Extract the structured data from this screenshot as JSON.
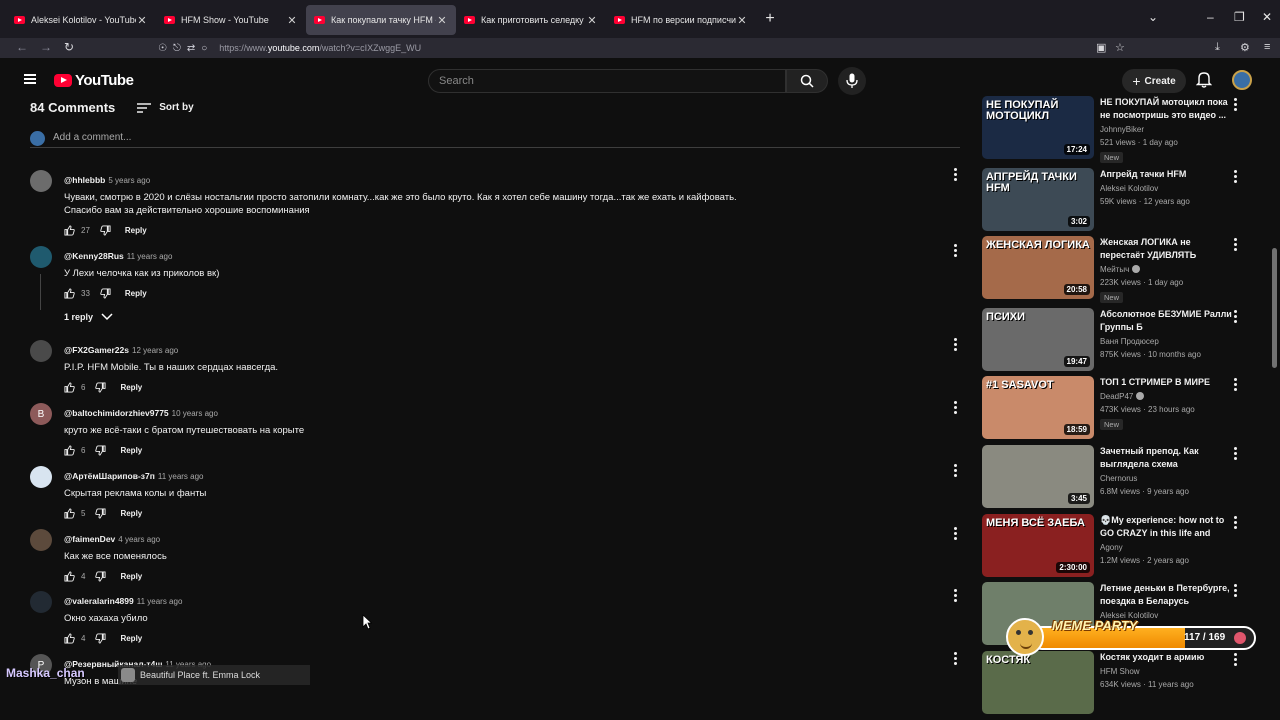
{
  "browser": {
    "tabs": [
      {
        "title": "Aleksei Kolotilov - YouTube",
        "active": false
      },
      {
        "title": "HFM Show - YouTube",
        "active": false
      },
      {
        "title": "Как покупали тачку HFM - YouTube",
        "active": true
      },
      {
        "title": "Как приготовить селедку под шубой",
        "active": false
      },
      {
        "title": "HFM по версии подписчиков",
        "active": false
      }
    ],
    "url_prefix": "https://www.",
    "url_host": "youtube.com",
    "url_path": "/watch?v=cIXZwggE_WU"
  },
  "header": {
    "logo_text": "YouTube",
    "search_placeholder": "Search",
    "create_label": "Create"
  },
  "comments_section": {
    "count_label": "84 Comments",
    "sort_label": "Sort by",
    "add_placeholder": "Add a comment...",
    "items": [
      {
        "author": "@hhlebbb",
        "time": "5 years ago",
        "text": "Чуваки, смотрю в 2020 и слёзы ностальгии просто затопили комнату...как же это было круто. Как я хотел себе машину тогда...так же ехать и кайфовать.",
        "text2": "Спасибо вам за действительно хорошие воспоминания",
        "likes": "27",
        "reply": "Reply",
        "avatar_color": "#6c6c6c",
        "initial": ""
      },
      {
        "author": "@Kenny28Rus",
        "time": "11 years ago",
        "text": "У Лехи челочка как из приколов вк)",
        "text2": "",
        "likes": "33",
        "reply": "Reply",
        "avatar_color": "#1f5a6e",
        "initial": ""
      },
      {
        "author": "@FX2Gamer22s",
        "time": "12 years ago",
        "text": "P.I.P. HFM Mobile. Ты в наших сердцах навсегда.",
        "text2": "",
        "likes": "6",
        "reply": "Reply",
        "avatar_color": "#4a4a4a",
        "initial": ""
      },
      {
        "author": "@baltochimidorzhiev9775",
        "time": "10 years ago",
        "text": "круто же всё-таки с братом путешествовать на корыте",
        "text2": "",
        "likes": "6",
        "reply": "Reply",
        "avatar_color": "#8d5a5a",
        "initial": "B"
      },
      {
        "author": "@АртёмШарипов-з7п",
        "time": "11 years ago",
        "text": "Скрытая реклама колы и фанты",
        "text2": "",
        "likes": "5",
        "reply": "Reply",
        "avatar_color": "#d8e4f0",
        "initial": ""
      },
      {
        "author": "@faimenDev",
        "time": "4 years ago",
        "text": "Как же все поменялось",
        "text2": "",
        "likes": "4",
        "reply": "Reply",
        "avatar_color": "#5c4a3c",
        "initial": ""
      },
      {
        "author": "@valeralarin4899",
        "time": "11 years ago",
        "text": "Окно хахаха убило",
        "text2": "",
        "likes": "4",
        "reply": "Reply",
        "avatar_color": "#222a33",
        "initial": ""
      },
      {
        "author": "@Резервныйканал-т4ш",
        "time": "11 years ago",
        "text": "Музон в машине",
        "text2": "",
        "likes": "",
        "reply": "",
        "avatar_color": "#555",
        "initial": "P"
      }
    ],
    "replies_toggle": "1 reply"
  },
  "recommendations": [
    {
      "title": "НЕ ПОКУПАЙ мотоцикл пока не посмотришь это видео ...",
      "channel": "JohnnyBiker",
      "views": "521 views",
      "age": "1 day ago",
      "new": "New",
      "duration": "17:24",
      "thumb_text": "НЕ ПОКУПАЙ МОТОЦИКЛ",
      "thumb_color": "#1b2a44",
      "verified": false
    },
    {
      "title": "Апгрейд тачки HFM",
      "channel": "Aleksei Kolotilov",
      "views": "59K views",
      "age": "12 years ago",
      "new": "",
      "duration": "3:02",
      "thumb_text": "АПГРЕЙД ТАЧКИ HFM",
      "thumb_color": "#3d4a55",
      "verified": false
    },
    {
      "title": "Женская ЛОГИКА не перестаёт УДИВЛЯТЬ",
      "channel": "Мейтыч",
      "views": "223K views",
      "age": "1 day ago",
      "new": "New",
      "duration": "20:58",
      "thumb_text": "ЖЕНСКАЯ ЛОГИКА",
      "thumb_color": "#a56a4a",
      "verified": true
    },
    {
      "title": "Абсолютное БЕЗУМИЕ Ралли Группы Б",
      "channel": "Ваня Продюсер",
      "views": "875K views",
      "age": "10 months ago",
      "new": "",
      "duration": "19:47",
      "thumb_text": "ПСИХИ",
      "thumb_color": "#6a6a6a",
      "verified": false
    },
    {
      "title": "ТОП 1 СТРИМЕР В МИРЕ",
      "channel": "DeadP47",
      "views": "473K views",
      "age": "23 hours ago",
      "new": "New",
      "duration": "18:59",
      "thumb_text": "#1 sasavot",
      "thumb_color": "#c98a6a",
      "verified": true
    },
    {
      "title": "Зачетный препод. Как выглядела схема",
      "channel": "Chernorus",
      "views": "6.8M views",
      "age": "9 years ago",
      "new": "",
      "duration": "3:45",
      "thumb_text": "",
      "thumb_color": "#8a8a80",
      "verified": false
    },
    {
      "title": "💀My experience: how not to GO CRAZY in this life and start...",
      "channel": "Agony",
      "views": "1.2M views",
      "age": "2 years ago",
      "new": "",
      "duration": "2:30:00",
      "thumb_text": "МЕНЯ ВСЁ ЗАЕБА",
      "thumb_color": "#8a2020",
      "verified": false
    },
    {
      "title": "Летние деньки в Петербурге, поездка в Беларусь",
      "channel": "Aleksei Kolotilov",
      "views": "",
      "age": "",
      "new": "",
      "duration": "",
      "thumb_text": "",
      "thumb_color": "#6f7f6a",
      "verified": false
    },
    {
      "title": "Костяк уходит в армию",
      "channel": "HFM Show",
      "views": "634K views",
      "age": "11 years ago",
      "new": "",
      "duration": "",
      "thumb_text": "КОСТЯК",
      "thumb_color": "#5a6b4a",
      "verified": false
    }
  ],
  "overlays": {
    "streamer_name": "Mashka_chan",
    "now_playing": "Beautiful Place ft. Emma Lock",
    "meme_title": "MEME PARTY",
    "meme_count": "117 / 169",
    "meme_progress": 0.69
  },
  "colors": {
    "youtube_red": "#ff0033",
    "meme_orange": "#f08a00"
  }
}
